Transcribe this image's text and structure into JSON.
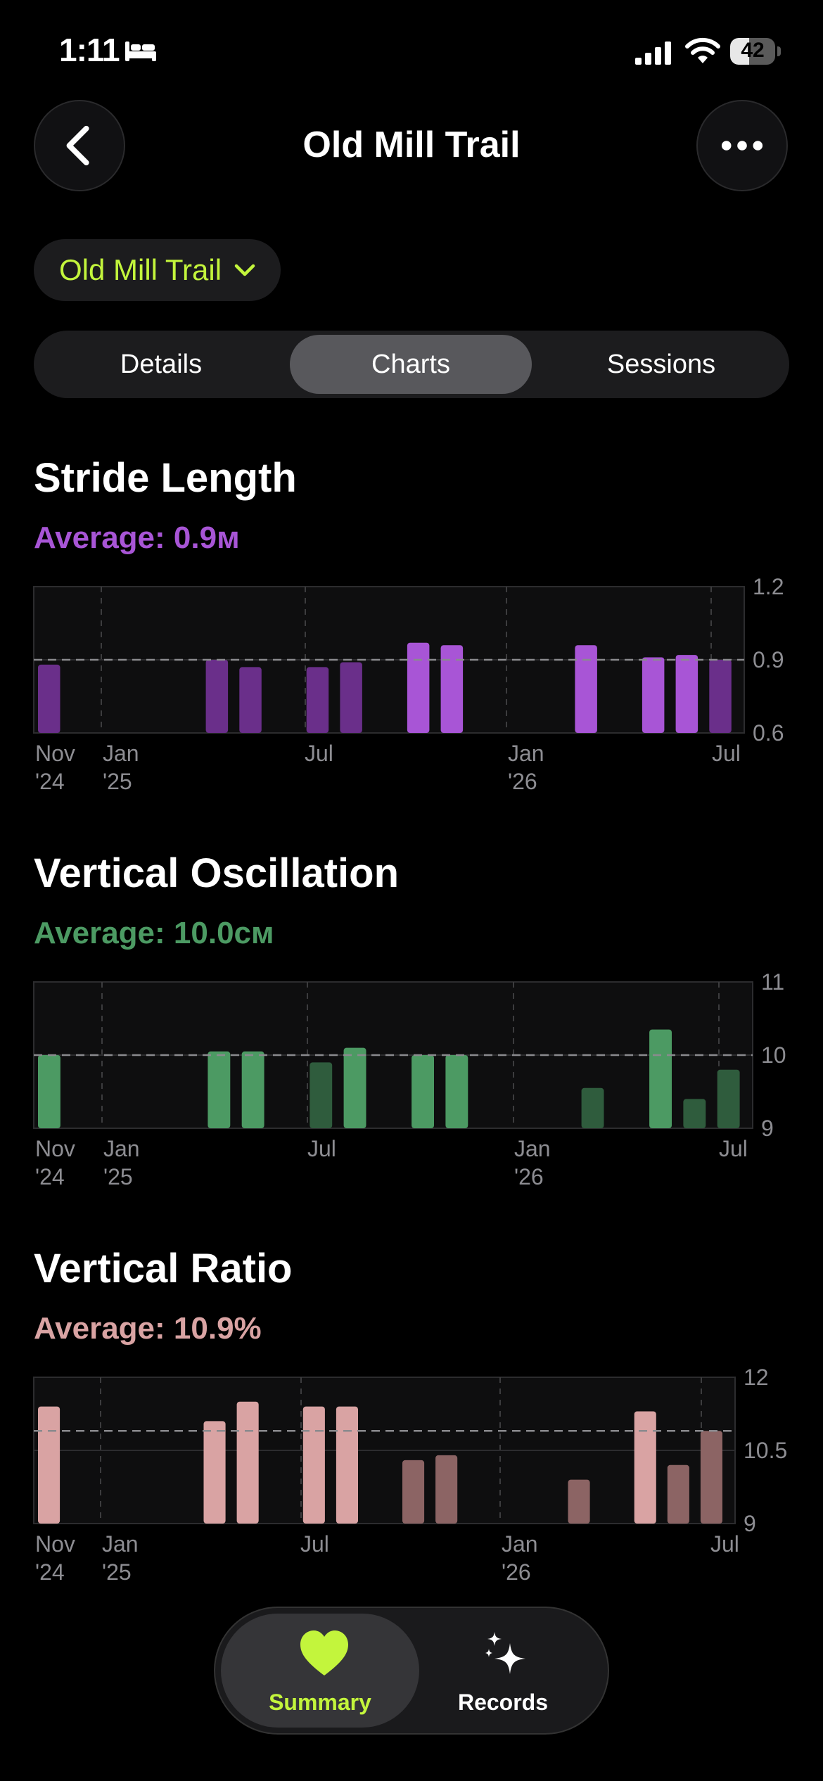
{
  "status_bar": {
    "time": "1:11",
    "battery": "42",
    "battery_level": 0.42,
    "icons": [
      "bed-icon",
      "cellular-signal-icon",
      "wifi-icon",
      "battery-icon"
    ]
  },
  "nav": {
    "title": "Old Mill Trail",
    "back_icon": "chevron-left-icon",
    "more_icon": "ellipsis-icon"
  },
  "trail_selector": {
    "label": "Old Mill Trail",
    "icon": "chevron-down-icon",
    "color": "#c3f53c"
  },
  "tabs": [
    {
      "label": "Details",
      "active": false
    },
    {
      "label": "Charts",
      "active": true
    },
    {
      "label": "Sessions",
      "active": false
    }
  ],
  "sections": [
    {
      "title": "Stride Length",
      "average_label": "Average: 0.9м",
      "color": "#a855d6"
    },
    {
      "title": "Vertical Oscillation",
      "average_label": "Average: 10.0см",
      "color": "#4c9a63"
    },
    {
      "title": "Vertical Ratio",
      "average_label": "Average: 10.9%",
      "color": "#d9a3a3"
    }
  ],
  "chart_data": [
    {
      "type": "bar",
      "title": "Stride Length",
      "ylim": [
        0.6,
        1.2
      ],
      "yticks": [
        "1.2",
        "0.9",
        "0.6"
      ],
      "average": 0.9,
      "xticks": [
        [
          "Nov",
          "'24"
        ],
        [
          "Jan",
          "'25"
        ],
        [
          "Jul",
          ""
        ],
        [
          "Jan",
          "'26"
        ],
        [
          "Jul",
          ""
        ]
      ],
      "values": [
        0.88,
        null,
        null,
        null,
        null,
        0.9,
        0.87,
        null,
        0.87,
        0.89,
        null,
        0.97,
        0.96,
        null,
        null,
        null,
        0.96,
        null,
        0.91,
        0.92,
        0.9
      ],
      "highlight": [
        false,
        false,
        false,
        false,
        false,
        false,
        false,
        false,
        false,
        false,
        false,
        true,
        true,
        false,
        false,
        false,
        true,
        false,
        true,
        true,
        false
      ],
      "color_bright": "#a855d6",
      "color_dim": "#6a2f8a"
    },
    {
      "type": "bar",
      "title": "Vertical Oscillation",
      "ylim": [
        9,
        11
      ],
      "yticks": [
        "11",
        "10",
        "9"
      ],
      "average": 10.0,
      "xticks": [
        [
          "Nov",
          "'24"
        ],
        [
          "Jan",
          "'25"
        ],
        [
          "Jul",
          ""
        ],
        [
          "Jan",
          "'26"
        ],
        [
          "Jul",
          ""
        ]
      ],
      "values": [
        10.0,
        null,
        null,
        null,
        null,
        10.05,
        10.05,
        null,
        9.9,
        10.1,
        null,
        10.0,
        10.0,
        null,
        null,
        null,
        9.55,
        null,
        10.35,
        9.4,
        9.8
      ],
      "highlight": [
        true,
        false,
        false,
        false,
        false,
        true,
        true,
        false,
        false,
        true,
        false,
        true,
        true,
        false,
        false,
        false,
        false,
        false,
        true,
        false,
        false
      ],
      "color_bright": "#4c9a63",
      "color_dim": "#2f5c3d"
    },
    {
      "type": "bar",
      "title": "Vertical Ratio",
      "ylim": [
        9,
        12
      ],
      "yticks": [
        "12",
        "10.5",
        "9"
      ],
      "average": 10.9,
      "xticks": [
        [
          "Nov",
          "'24"
        ],
        [
          "Jan",
          "'25"
        ],
        [
          "Jul",
          ""
        ],
        [
          "Jan",
          "'26"
        ],
        [
          "Jul",
          ""
        ]
      ],
      "values": [
        11.4,
        null,
        null,
        null,
        null,
        11.1,
        11.5,
        null,
        11.4,
        11.4,
        null,
        10.3,
        10.4,
        null,
        null,
        null,
        9.9,
        null,
        11.3,
        10.2,
        10.9
      ],
      "highlight": [
        true,
        false,
        false,
        false,
        false,
        true,
        true,
        false,
        true,
        true,
        false,
        false,
        false,
        false,
        false,
        false,
        false,
        false,
        true,
        false,
        false
      ],
      "color_bright": "#d9a3a3",
      "color_dim": "#8c6464"
    }
  ],
  "tab_bar": [
    {
      "label": "Summary",
      "icon": "heart-icon",
      "active": true,
      "color": "#c3f53c"
    },
    {
      "label": "Records",
      "icon": "sparkles-icon",
      "active": false,
      "color": "#ffffff"
    }
  ]
}
